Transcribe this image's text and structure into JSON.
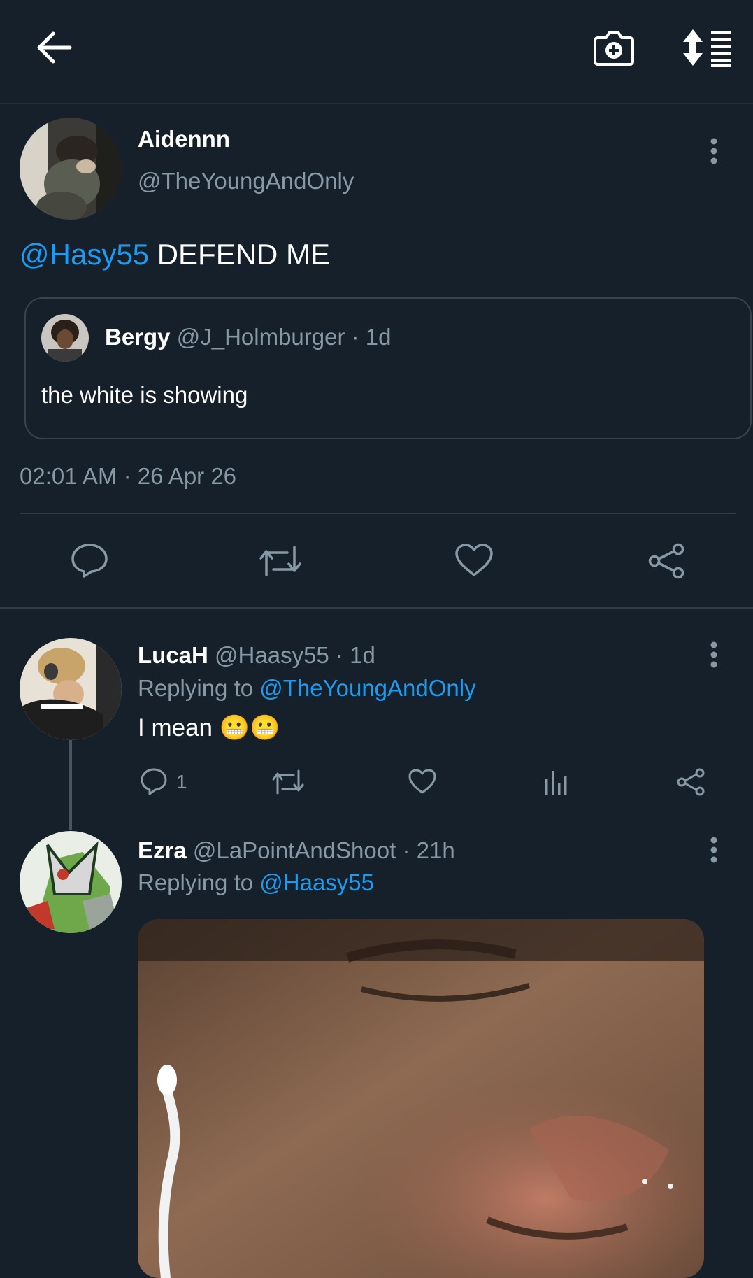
{
  "topbar": {
    "back_icon": "arrow-left-icon",
    "camera_icon": "camera-add-icon",
    "sort_icon": "sort-list-icon"
  },
  "main_tweet": {
    "display_name": "Aidennn",
    "handle": "@TheYoungAndOnly",
    "mention": "@Hasy55",
    "text": " DEFEND ME",
    "timestamp": "02:01 AM · 26 Apr 26",
    "quoted": {
      "display_name": "Bergy",
      "handle": "@J_Holmburger",
      "age": " · 1d",
      "text": "the white is showing"
    }
  },
  "reply1": {
    "display_name": "LucaH",
    "handle": "@Haasy55",
    "age": " · 1d",
    "replying_prefix": "Replying to ",
    "replying_to": "@TheYoungAndOnly",
    "text": "I mean ",
    "emoji": "😬😬",
    "reply_count": "1"
  },
  "reply2": {
    "display_name": "Ezra",
    "handle": "@LaPointAndShoot",
    "age": " · 21h",
    "replying_prefix": "Replying to ",
    "replying_to": "@Haasy55"
  },
  "colors": {
    "background": "#15202b",
    "accent": "#1d9bf0",
    "muted": "#8899a6"
  }
}
